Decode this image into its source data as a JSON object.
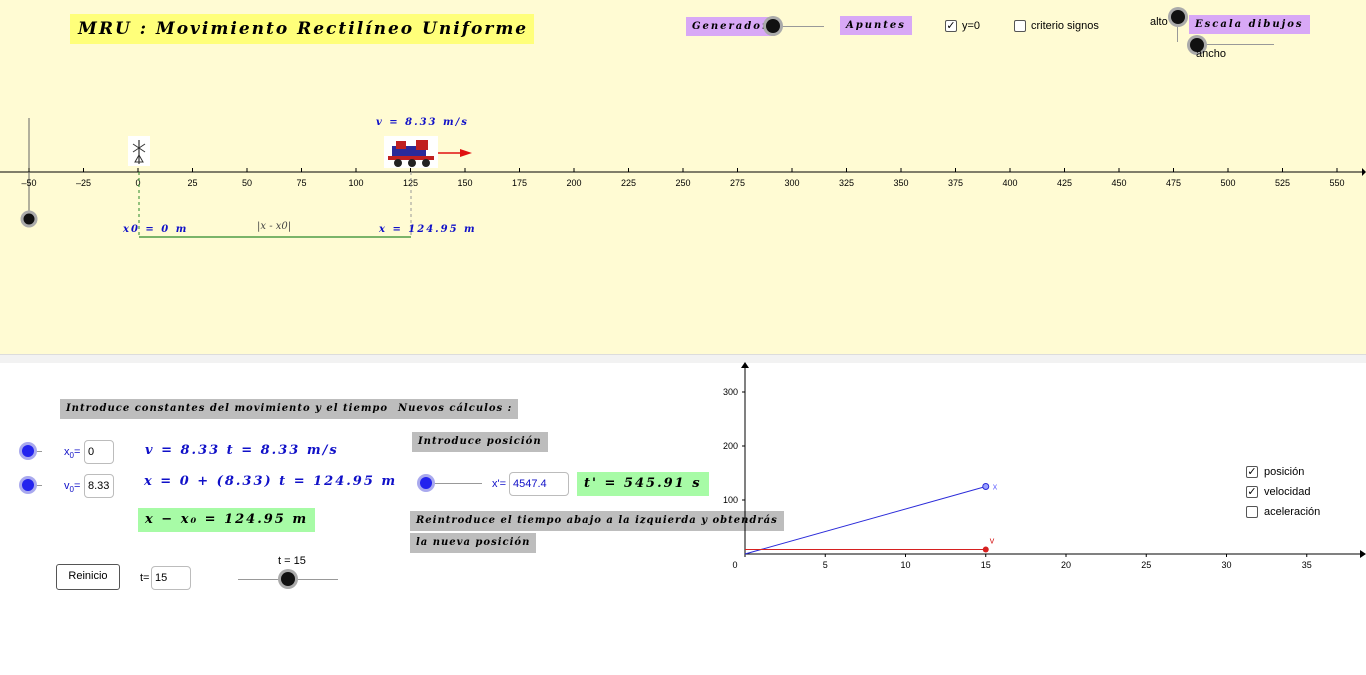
{
  "title": "MRU : Movimiento Rectilíneo Uniforme",
  "top_buttons": {
    "generador": "Generador",
    "apuntes": "Apuntes",
    "escala": "Escala dibujos"
  },
  "checkboxes": {
    "y0": "y=0",
    "criterio": "criterio signos",
    "y0_checked": true,
    "criterio_checked": false
  },
  "scale_labels": {
    "alto": "alto",
    "ancho": "ancho"
  },
  "axis_ticks": [
    "-50",
    "-25",
    "0",
    "25",
    "50",
    "75",
    "100",
    "125",
    "150",
    "175",
    "200",
    "225",
    "250",
    "275",
    "300",
    "325",
    "350",
    "375",
    "400",
    "425",
    "450",
    "475",
    "500",
    "525",
    "550"
  ],
  "sim": {
    "velocity_label": "v = 8.33 m/s",
    "x0_label": "x0 = 0 m",
    "dist_label": "|x - x0|",
    "x_label": "x = 124.95 m",
    "x0_value": 0,
    "x_value": 124.95
  },
  "panel": {
    "intro": "Introduce constantes del movimiento y el tiempo",
    "nuevos": "Nuevos cálculos :",
    "introduce_pos": "Introduce posición",
    "reintroduce_1": "Reintroduce el tiempo abajo a la izquierda y obtendrás",
    "reintroduce_2": "la nueva posición",
    "x0_field_label": "x",
    "x0_field_sub": "0",
    "x0_value": "0",
    "v0_field_label": "v",
    "v0_field_sub": "0",
    "v0_value": "8.33",
    "eq_v": "v = 8.33 t = 8.33  m/s",
    "eq_x": "x = 0 + (8.33) t = 124.95 m",
    "eq_diff": "x − x₀ = 124.95 m",
    "xprime_label": "x'=",
    "xprime_value": "4547.4",
    "tprime": "t' = 545.91 s",
    "reinicio": "Reinicio",
    "t_label": "t=",
    "t_value": "15",
    "t_slider_label": "t = 15"
  },
  "graph": {
    "x_ticks": [
      "0",
      "5",
      "10",
      "15",
      "20",
      "25",
      "30",
      "35"
    ],
    "y_ticks": [
      "100",
      "200",
      "300"
    ],
    "point_x_label": "x",
    "point_v_label": "v",
    "options": [
      {
        "label": "posición",
        "checked": true
      },
      {
        "label": "velocidad",
        "checked": true
      },
      {
        "label": "aceleración",
        "checked": false
      }
    ],
    "colors": {
      "position": "#2b2bd9",
      "velocity": "#d62020"
    }
  },
  "chart_data": {
    "type": "line",
    "x": [
      0,
      15
    ],
    "series": [
      {
        "name": "x",
        "values": [
          0,
          124.95
        ]
      },
      {
        "name": "v",
        "values": [
          8.33,
          8.33
        ]
      }
    ],
    "xlim": [
      0,
      37
    ],
    "ylim": [
      0,
      330
    ],
    "xticks": [
      0,
      5,
      10,
      15,
      20,
      25,
      30,
      35
    ],
    "yticks": [
      100,
      200,
      300
    ]
  }
}
